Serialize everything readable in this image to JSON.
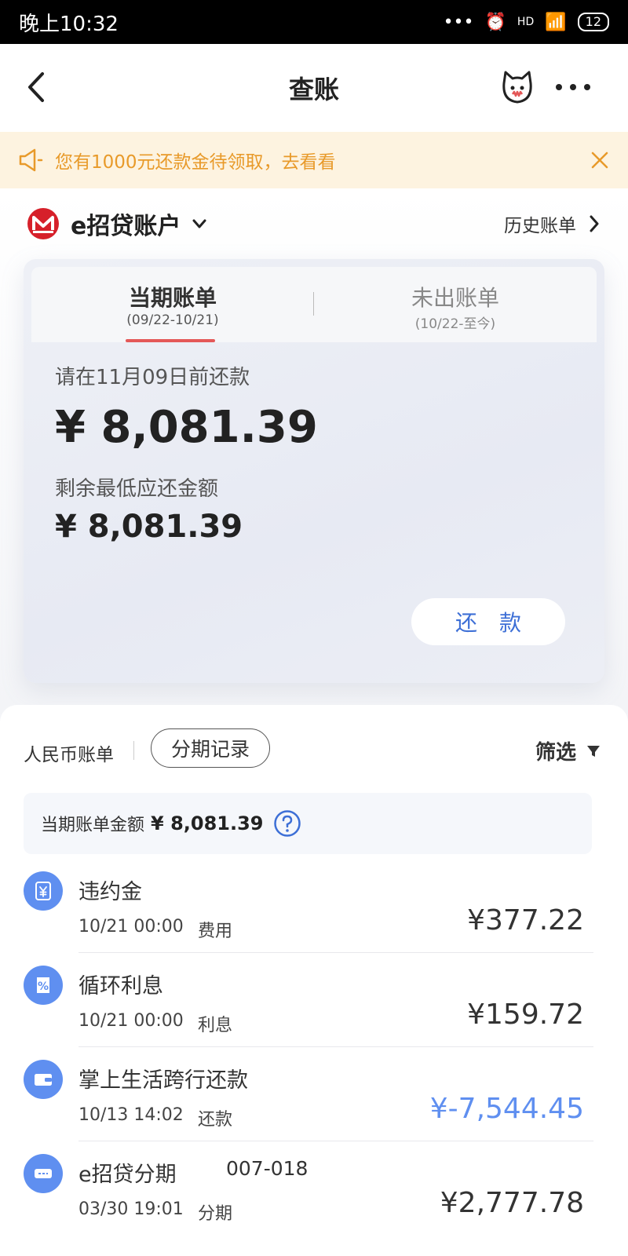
{
  "status_bar": {
    "time": "晚上10:32",
    "network": "HD",
    "battery": "12"
  },
  "nav": {
    "title": "查账"
  },
  "notice": {
    "text": "您有1000元还款金待领取，去看看"
  },
  "account": {
    "name": "e招贷账户",
    "history_label": "历史账单"
  },
  "bill_tabs": [
    {
      "label": "当期账单",
      "range": "(09/22-10/21)",
      "active": true
    },
    {
      "label": "未出账单",
      "range": "(10/22-至今)",
      "active": false
    }
  ],
  "bill": {
    "due_label": "请在11月09日前还款",
    "due_amount": "¥ 8,081.39",
    "min_label": "剩余最低应还金额",
    "min_amount": "¥ 8,081.39",
    "repay_label": "还款"
  },
  "list_header": {
    "currency_label": "人民币账单",
    "installment_label": "分期记录",
    "filter_label": "筛选"
  },
  "summary": {
    "label": "当期账单金额",
    "amount": "¥ 8,081.39"
  },
  "transactions": [
    {
      "title": "违约金",
      "code": "",
      "time": "10/21 00:00",
      "type": "费用",
      "amount": "¥377.22",
      "icon": "yen-icon"
    },
    {
      "title": "循环利息",
      "code": "",
      "time": "10/21 00:00",
      "type": "利息",
      "amount": "¥159.72",
      "icon": "percent-icon"
    },
    {
      "title": "掌上生活跨行还款",
      "code": "",
      "time": "10/13 14:02",
      "type": "还款",
      "amount": "¥-7,544.45",
      "icon": "wallet-icon"
    },
    {
      "title": "e招贷分期",
      "code": "007-018",
      "time": "03/30 19:01",
      "type": "分期",
      "amount": "¥2,777.78",
      "icon": "installment-icon"
    }
  ],
  "colors": {
    "accent_blue": "#3d6fd6",
    "icon_blue": "#5f8ff0",
    "notice_orange": "#e89a2a",
    "tab_underline": "#e45858",
    "logo_red": "#d6202a"
  }
}
